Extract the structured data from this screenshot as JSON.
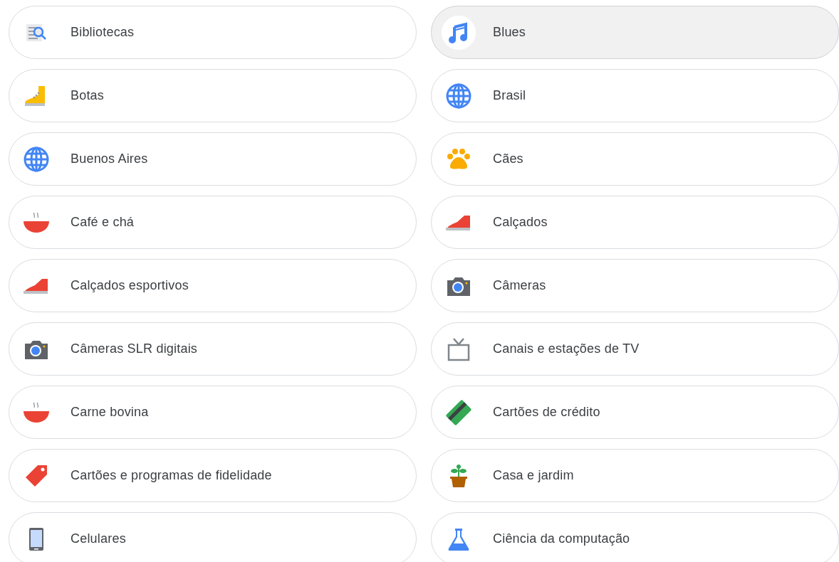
{
  "categories": [
    {
      "label": "Bibliotecas",
      "kind": "library",
      "selected": false
    },
    {
      "label": "Blues",
      "kind": "music",
      "selected": true
    },
    {
      "label": "Botas",
      "kind": "boot",
      "selected": false
    },
    {
      "label": "Brasil",
      "kind": "globe",
      "selected": false
    },
    {
      "label": "Buenos Aires",
      "kind": "globe",
      "selected": false
    },
    {
      "label": "Cães",
      "kind": "paw",
      "selected": false
    },
    {
      "label": "Café e chá",
      "kind": "bowl",
      "selected": false
    },
    {
      "label": "Calçados",
      "kind": "sneaker",
      "selected": false
    },
    {
      "label": "Calçados esportivos",
      "kind": "sneaker",
      "selected": false
    },
    {
      "label": "Câmeras",
      "kind": "camera",
      "selected": false
    },
    {
      "label": "Câmeras SLR digitais",
      "kind": "camera",
      "selected": false
    },
    {
      "label": "Canais e estações de TV",
      "kind": "tv",
      "selected": false
    },
    {
      "label": "Carne bovina",
      "kind": "bowl",
      "selected": false
    },
    {
      "label": "Cartões de crédito",
      "kind": "card",
      "selected": false
    },
    {
      "label": "Cartões e programas de fidelidade",
      "kind": "tag",
      "selected": false
    },
    {
      "label": "Casa e jardim",
      "kind": "plant",
      "selected": false
    },
    {
      "label": "Celulares",
      "kind": "phone",
      "selected": false
    },
    {
      "label": "Ciência da computação",
      "kind": "flask",
      "selected": false
    }
  ]
}
